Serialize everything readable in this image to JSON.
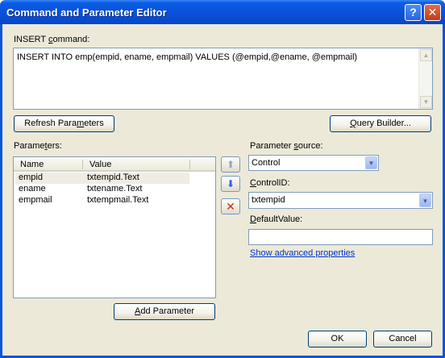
{
  "window": {
    "title": "Command and Parameter Editor",
    "help_glyph": "?",
    "close_glyph": "✕"
  },
  "insert_command": {
    "label_pre": "INSERT ",
    "label_accel": "c",
    "label_post": "ommand:",
    "value": "INSERT INTO emp(empid, ename, empmail) VALUES (@empid,@ename, @empmail)"
  },
  "buttons": {
    "refresh_pre": "Refresh Para",
    "refresh_accel": "m",
    "refresh_post": "eters",
    "query_pre": "",
    "query_accel": "Q",
    "query_post": "uery Builder...",
    "add_pre": "",
    "add_accel": "A",
    "add_post": "dd Parameter",
    "ok": "OK",
    "cancel": "Cancel"
  },
  "parameters": {
    "label_pre": "Parame",
    "label_accel": "t",
    "label_post": "ers:",
    "columns": [
      "Name",
      "Value"
    ],
    "rows": [
      {
        "name": "empid",
        "value": "txtempid.Text"
      },
      {
        "name": "ename",
        "value": "txtename.Text"
      },
      {
        "name": "empmail",
        "value": "txtempmail.Text"
      }
    ]
  },
  "side_buttons": {
    "up_glyph": "⬆",
    "down_glyph": "⬇",
    "delete_glyph": "✕"
  },
  "parameter_source": {
    "label_pre": "Parameter ",
    "label_accel": "s",
    "label_post": "ource:",
    "value": "Control"
  },
  "control_id": {
    "label_pre": "",
    "label_accel": "C",
    "label_post": "ontrolID:",
    "value": "txtempid"
  },
  "default_value": {
    "label_pre": "",
    "label_accel": "D",
    "label_post": "efaultValue:",
    "value": ""
  },
  "advanced_link": "Show advanced properties",
  "colors": {
    "titlebar": "#0a50d6",
    "client": "#ece9d8",
    "delete_icon": "#d42a0c",
    "arrow_icon": "#2f62c7",
    "link": "#0033cc"
  }
}
